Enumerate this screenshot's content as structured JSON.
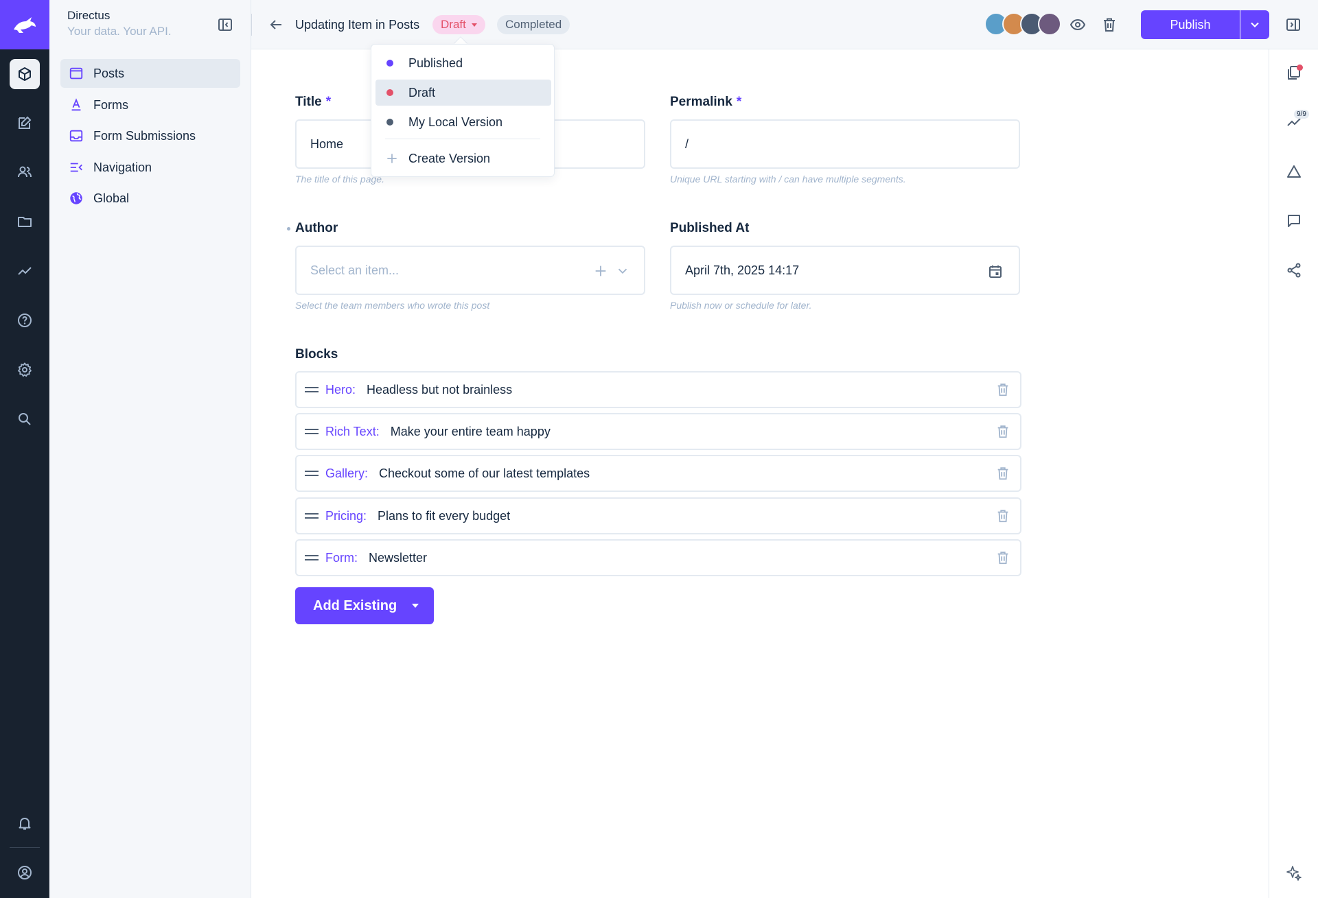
{
  "colors": {
    "accent": "#6644ff",
    "draft": "#e35169",
    "muted": "#a2b5cd",
    "rail": "#18222f"
  },
  "brand": {
    "title": "Directus",
    "subtitle": "Your data. Your API."
  },
  "nav": {
    "items": [
      {
        "label": "Posts",
        "icon": "posts-icon",
        "active": true
      },
      {
        "label": "Forms",
        "icon": "forms-icon"
      },
      {
        "label": "Form Submissions",
        "icon": "inbox-icon"
      },
      {
        "label": "Navigation",
        "icon": "navigation-icon"
      },
      {
        "label": "Global",
        "icon": "globe-icon"
      }
    ]
  },
  "header": {
    "title": "Updating Item in Posts",
    "version_pill": "Draft",
    "status_pill": "Completed",
    "publish_label": "Publish"
  },
  "version_menu": {
    "items": [
      {
        "label": "Published",
        "color": "#6644ff"
      },
      {
        "label": "Draft",
        "color": "#e35169",
        "active": true
      },
      {
        "label": "My Local Version",
        "color": "#4f5f73"
      }
    ],
    "create_label": "Create Version"
  },
  "form": {
    "title": {
      "label": "Title",
      "required": "*",
      "value": "Home",
      "hint": "The title of this page."
    },
    "permalink": {
      "label": "Permalink",
      "required": "*",
      "value": "/",
      "hint": "Unique URL starting with / can have multiple segments."
    },
    "author": {
      "label": "Author",
      "placeholder": "Select an item...",
      "hint": "Select the team members who wrote this post"
    },
    "published_at": {
      "label": "Published At",
      "value": "April 7th, 2025 14:17",
      "hint": "Publish now or schedule for later."
    },
    "blocks": {
      "label": "Blocks",
      "items": [
        {
          "type": "Hero:",
          "value": "Headless but not brainless"
        },
        {
          "type": "Rich Text:",
          "value": "Make your entire team happy"
        },
        {
          "type": "Gallery:",
          "value": "Checkout some of our latest templates"
        },
        {
          "type": "Pricing:",
          "value": "Plans to fit every budget"
        },
        {
          "type": "Form:",
          "value": "Newsletter"
        }
      ],
      "add_existing_label": "Add Existing"
    }
  },
  "right_sidebar": {
    "revisions_badge": "9/9"
  }
}
